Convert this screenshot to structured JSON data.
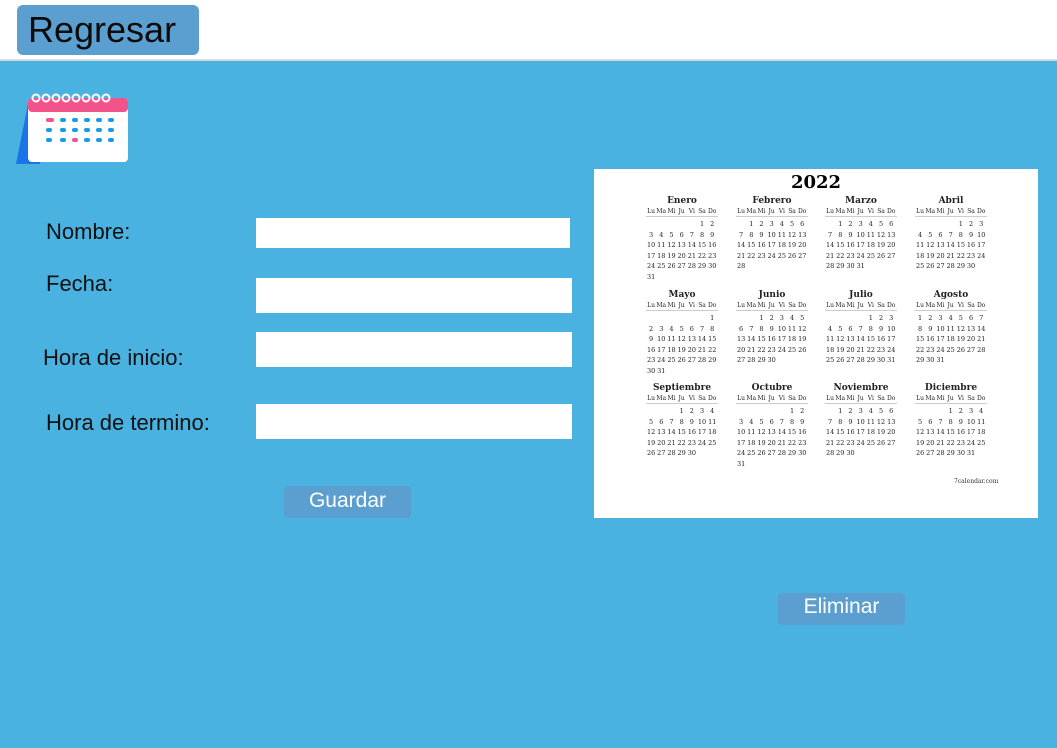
{
  "header": {
    "back_label": "Regresar"
  },
  "form": {
    "nombre_label": "Nombre:",
    "fecha_label": "Fecha:",
    "hora_inicio_label": "Hora de inicio:",
    "hora_termino_label": "Hora de termino:",
    "nombre_value": "",
    "fecha_value": "",
    "hora_inicio_value": "",
    "hora_termino_value": "",
    "save_label": "Guardar"
  },
  "delete_label": "Eliminar",
  "calendar": {
    "year": "2022",
    "credit": "7calendar.com",
    "weekdays": [
      "Lu",
      "Ma",
      "Mi",
      "Ju",
      "Vi",
      "Sa",
      "Do"
    ],
    "months": [
      {
        "name": "Enero",
        "offset": 5,
        "days": 31
      },
      {
        "name": "Febrero",
        "offset": 1,
        "days": 28
      },
      {
        "name": "Marzo",
        "offset": 1,
        "days": 31
      },
      {
        "name": "Abril",
        "offset": 4,
        "days": 30
      },
      {
        "name": "Mayo",
        "offset": 6,
        "days": 31
      },
      {
        "name": "Junio",
        "offset": 2,
        "days": 30
      },
      {
        "name": "Julio",
        "offset": 4,
        "days": 31
      },
      {
        "name": "Agosto",
        "offset": 0,
        "days": 31
      },
      {
        "name": "Septiembre",
        "offset": 3,
        "days": 30
      },
      {
        "name": "Octubre",
        "offset": 5,
        "days": 31
      },
      {
        "name": "Noviembre",
        "offset": 1,
        "days": 30
      },
      {
        "name": "Diciembre",
        "offset": 3,
        "days": 31
      }
    ]
  },
  "colors": {
    "background": "#4ab2e0",
    "button": "#5b9fd0"
  },
  "icons": {
    "calendar": "calendar-icon"
  }
}
